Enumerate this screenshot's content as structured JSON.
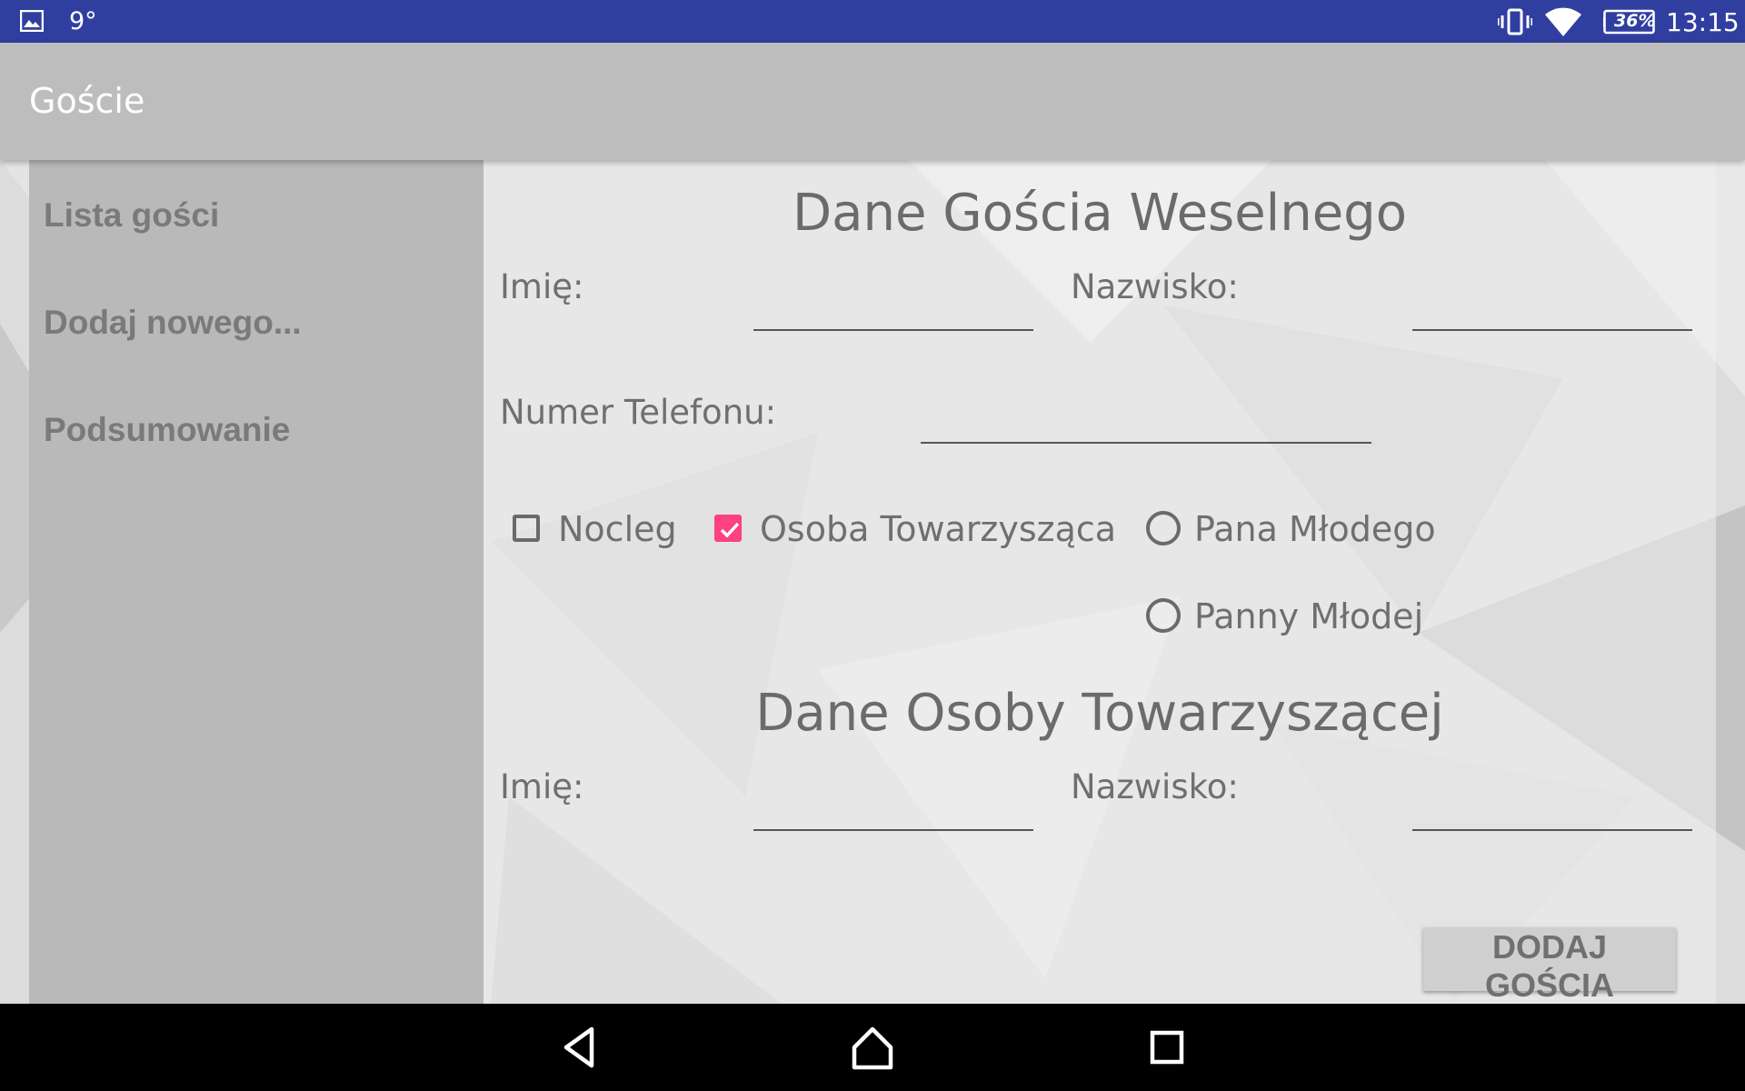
{
  "status_bar": {
    "temperature": "9°",
    "battery": "36%",
    "time": "13:15",
    "icons": [
      "image-icon",
      "vibrate-icon",
      "wifi-icon",
      "battery-icon"
    ]
  },
  "app_bar": {
    "title": "Goście"
  },
  "sidebar": {
    "items": [
      {
        "label": "Lista gości"
      },
      {
        "label": "Dodaj nowego..."
      },
      {
        "label": "Podsumowanie"
      }
    ]
  },
  "form": {
    "guest_heading": "Dane Gościa Weselnego",
    "first_name_label": "Imię:",
    "first_name_value": "",
    "last_name_label": "Nazwisko:",
    "last_name_value": "",
    "phone_label": "Numer Telefonu:",
    "phone_value": "",
    "options": {
      "overnight": {
        "label": "Nocleg",
        "checked": false
      },
      "companion": {
        "label": "Osoba Towarzysząca",
        "checked": true
      },
      "groom_side": {
        "label": "Pana Młodego",
        "selected": false
      },
      "bride_side": {
        "label": "Panny Młodej",
        "selected": false
      }
    },
    "companion_heading": "Dane Osoby Towarzyszącej",
    "companion_first_name_label": "Imię:",
    "companion_first_name_value": "",
    "companion_last_name_label": "Nazwisko:",
    "companion_last_name_value": "",
    "add_button_label": "DODAJ GOŚCIA"
  },
  "colors": {
    "status_bar": "#303f9f",
    "app_bar": "#bdbdbd",
    "sidebar": "#b9b9b9",
    "accent": "#ff4081",
    "nav_bar": "#000000"
  },
  "nav_bar": {
    "buttons": [
      "back-icon",
      "home-icon",
      "recents-icon"
    ]
  }
}
